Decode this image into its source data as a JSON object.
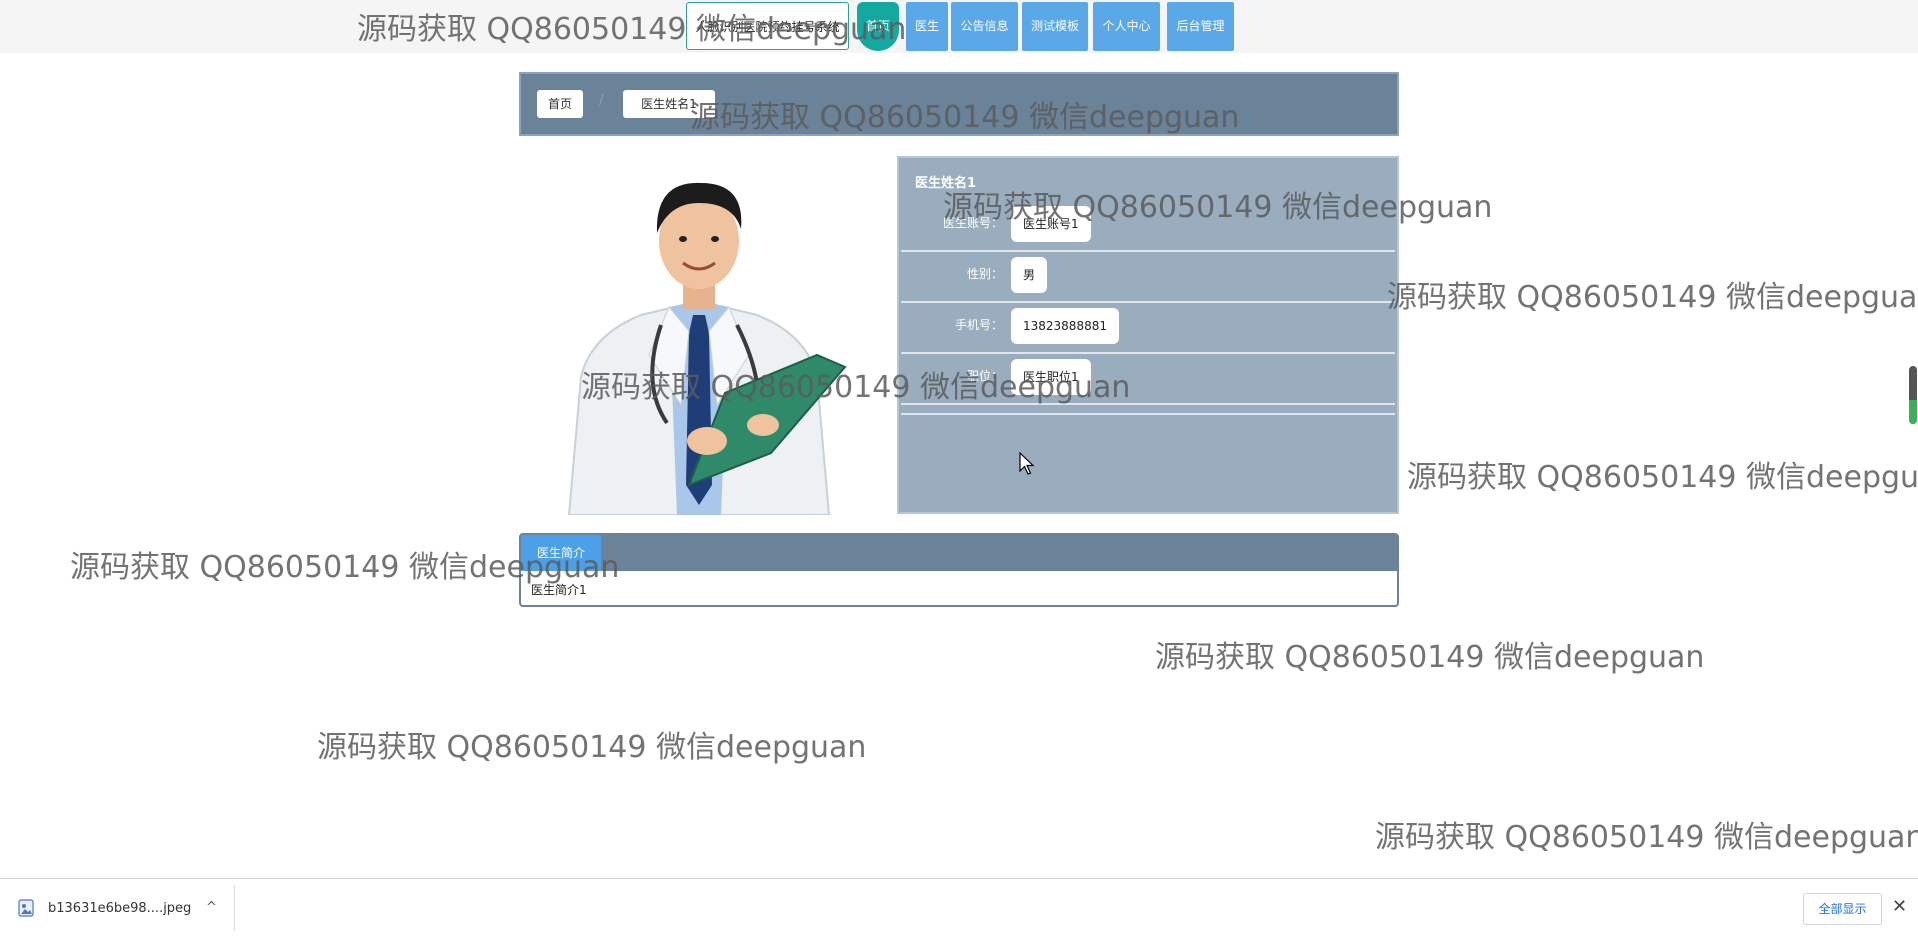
{
  "header": {
    "site_title": "人脸识别医院预约挂号系统",
    "nav": {
      "home": "首页",
      "doctor": "医生",
      "notice": "公告信息",
      "test": "测试模板",
      "profile": "个人中心",
      "admin": "后台管理"
    }
  },
  "breadcrumb": {
    "home": "首页",
    "separator": "/",
    "current": "医生姓名1"
  },
  "doctor": {
    "name": "医生姓名1",
    "fields": [
      {
        "label": "医生账号：",
        "value": "医生账号1"
      },
      {
        "label": "性别：",
        "value": "男"
      },
      {
        "label": "手机号：",
        "value": "13823888881"
      },
      {
        "label": "职位：",
        "value": "医生职位1"
      }
    ]
  },
  "intro": {
    "tab_label": "医生简介",
    "content": "医生简介1"
  },
  "watermark": {
    "text": "源码获取 QQ86050149 微信deepguan"
  },
  "downloads": {
    "file_name": "b13631e6be98....jpeg",
    "caret": "^",
    "show_all": "全部显示",
    "close": "✕"
  },
  "colors": {
    "header_bg": "#f5f5f5",
    "nav_blue": "#5aa8e8",
    "nav_teal": "#14a8a1",
    "panel_slate": "#6a8399",
    "info_panel": "#9aadbf",
    "tab_blue": "#4ba0e8"
  }
}
